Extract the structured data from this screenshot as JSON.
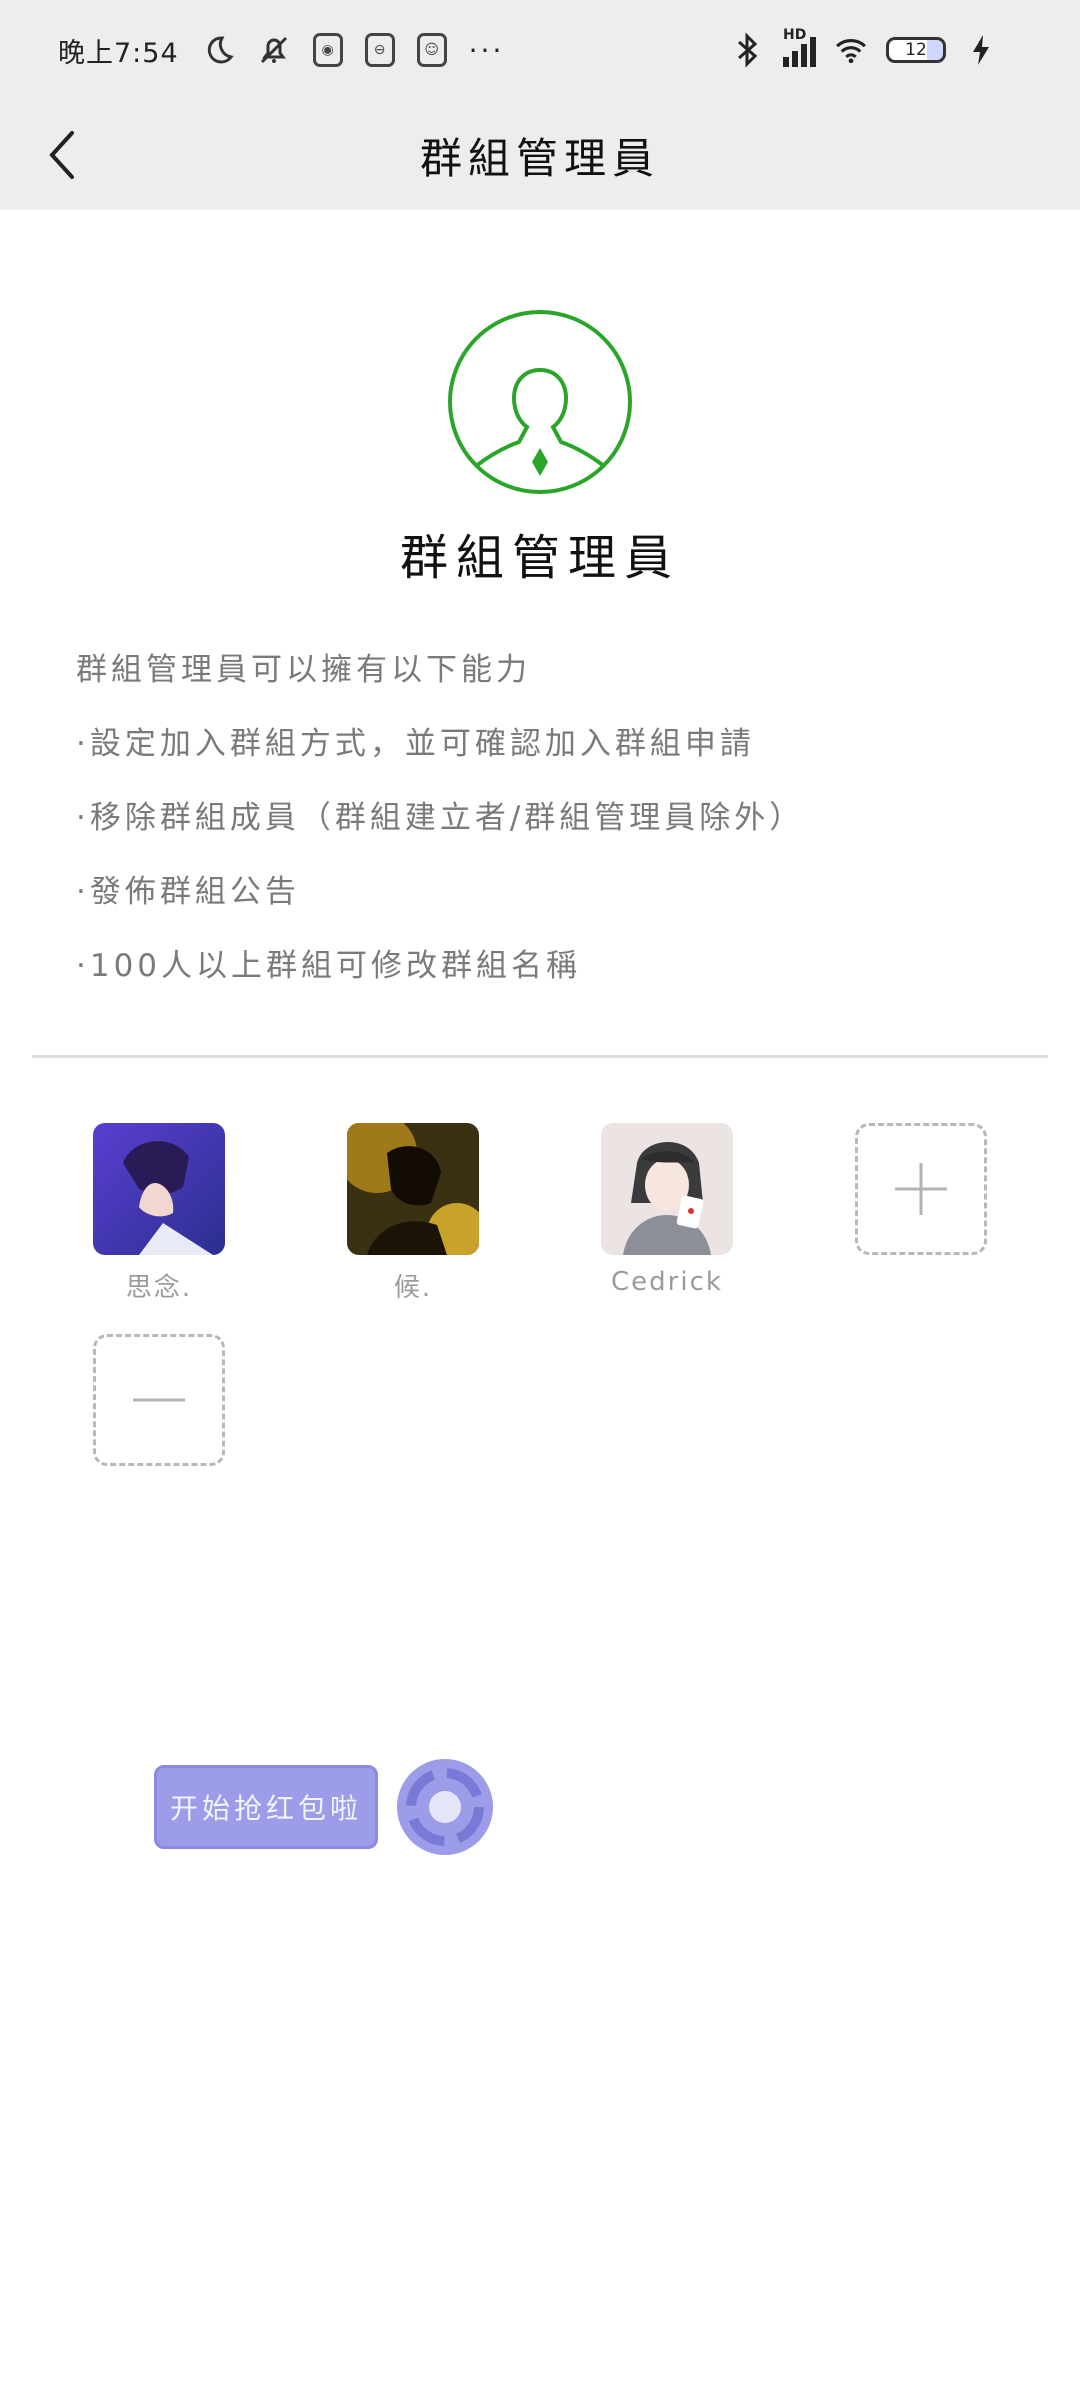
{
  "status_bar": {
    "time": "晚上7:54",
    "more": "···",
    "network": "HD",
    "battery_level": "12"
  },
  "header": {
    "title": "群組管理員",
    "back_icon": "chevron-left-icon"
  },
  "hero": {
    "icon": "admin-person-icon",
    "title": "群組管理員",
    "accent_color": "#2aa52a"
  },
  "description": {
    "intro": "群組管理員可以擁有以下能力",
    "bullets": [
      "·設定加入群組方式，並可確認加入群組申請",
      "·移除群組成員（群組建立者/群組管理員除外）",
      "·發佈群組公告",
      "·100人以上群組可修改群組名稱"
    ]
  },
  "members": [
    {
      "name": "思念."
    },
    {
      "name": "候."
    },
    {
      "name": "Cedrick"
    }
  ],
  "actions": {
    "add_icon": "plus-icon",
    "remove_icon": "minus-icon"
  },
  "floating": {
    "label": "开始抢红包啦",
    "dial_icon": "dial-icon",
    "color": "#9c9ce8"
  }
}
